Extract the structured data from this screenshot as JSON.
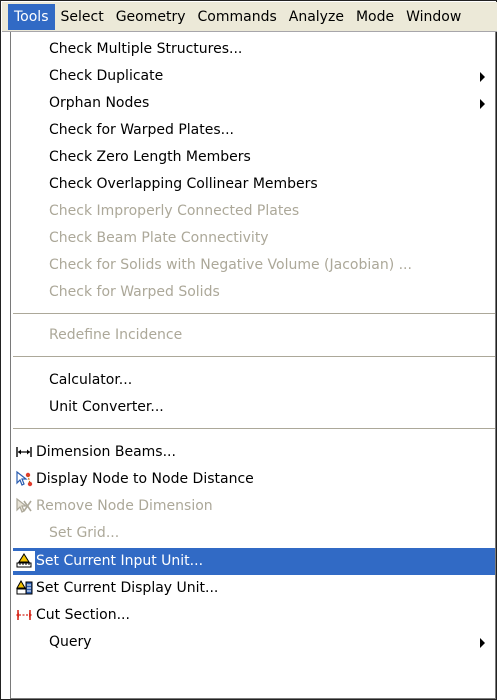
{
  "menubar": {
    "items": [
      "Tools",
      "Select",
      "Geometry",
      "Commands",
      "Analyze",
      "Mode",
      "Window"
    ],
    "active": "Tools"
  },
  "menu": {
    "items": [
      {
        "label": "Check Multiple Structures...",
        "enabled": true
      },
      {
        "label": "Check Duplicate",
        "enabled": true,
        "submenu": true
      },
      {
        "label": "Orphan Nodes",
        "enabled": true,
        "submenu": true
      },
      {
        "label": "Check for Warped Plates...",
        "enabled": true
      },
      {
        "label": "Check Zero Length Members",
        "enabled": true
      },
      {
        "label": "Check Overlapping Collinear Members",
        "enabled": true
      },
      {
        "label": "Check Improperly Connected Plates",
        "enabled": false
      },
      {
        "label": "Check Beam Plate Connectivity",
        "enabled": false
      },
      {
        "label": "Check for Solids with Negative Volume (Jacobian) ...",
        "enabled": false
      },
      {
        "label": "Check for Warped Solids",
        "enabled": false
      },
      {
        "label": "Redefine Incidence",
        "enabled": false
      },
      {
        "label": "Calculator...",
        "enabled": true
      },
      {
        "label": "Unit Converter...",
        "enabled": true
      },
      {
        "label": "Dimension Beams...",
        "enabled": true,
        "icon": "dimension-beams-icon"
      },
      {
        "label": "Display Node to Node Distance",
        "enabled": true,
        "icon": "node-distance-icon"
      },
      {
        "label": "Remove Node Dimension",
        "enabled": false,
        "icon": "remove-node-dimension-icon"
      },
      {
        "label": "Set Grid...",
        "enabled": false
      },
      {
        "label": "Set Current Input Unit...",
        "enabled": true,
        "icon": "input-unit-icon",
        "highlighted": true
      },
      {
        "label": "Set Current Display Unit...",
        "enabled": true,
        "icon": "display-unit-icon"
      },
      {
        "label": "Cut Section...",
        "enabled": true,
        "icon": "cut-section-icon"
      },
      {
        "label": "Query",
        "enabled": true,
        "submenu": true
      }
    ]
  },
  "colors": {
    "highlight": "#316ac5",
    "disabled_text": "#aca899",
    "menubar_bg": "#ece9d8"
  }
}
